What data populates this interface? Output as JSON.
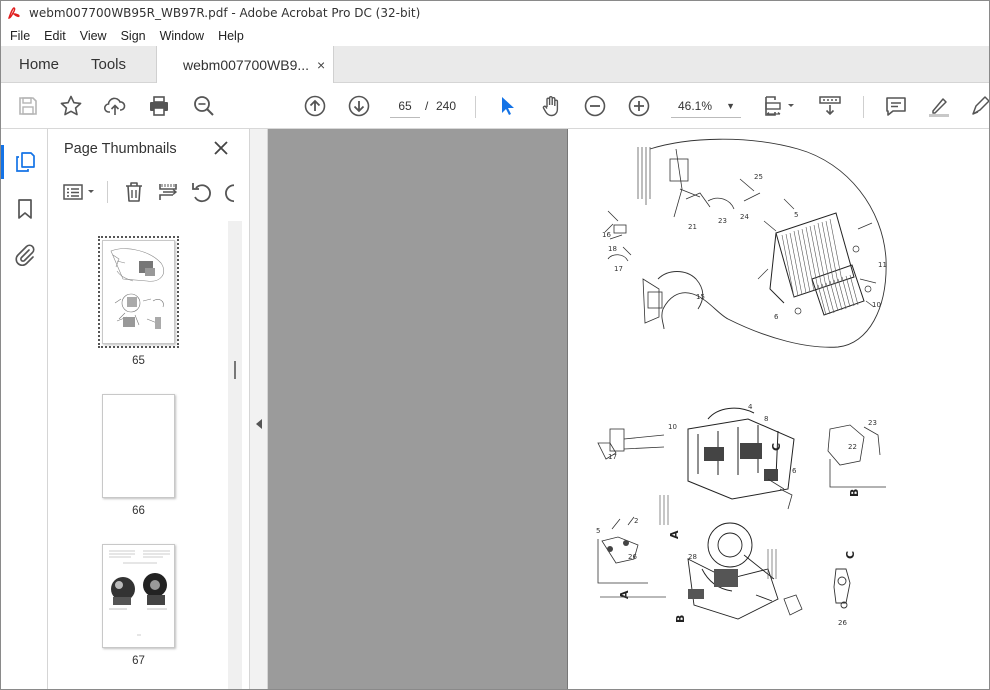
{
  "window": {
    "title": "webm007700WB95R_WB97R.pdf - Adobe Acrobat Pro DC (32-bit)"
  },
  "menu": [
    "File",
    "Edit",
    "View",
    "Sign",
    "Window",
    "Help"
  ],
  "tabs": {
    "home": "Home",
    "tools": "Tools",
    "document": "webm007700WB9...",
    "close_symbol": "×"
  },
  "toolbar": {
    "current_page": "65",
    "page_separator": "/",
    "total_pages": "240",
    "zoom": "46.1%",
    "icons": [
      "save-icon",
      "bookmark-star-icon",
      "upload-cloud-icon",
      "print-icon",
      "zoom-search-icon",
      "page-up-icon",
      "page-down-icon",
      "select-cursor-icon",
      "hand-pan-icon",
      "zoom-out-icon",
      "zoom-in-icon",
      "page-fit-icon",
      "scroll-mode-icon",
      "comment-icon",
      "highlight-pen-icon",
      "draw-pen-icon"
    ]
  },
  "left_rail": {
    "icons": [
      "page-thumbnails-icon",
      "bookmarks-icon",
      "attachments-icon"
    ],
    "active": "page-thumbnails-icon"
  },
  "thumbnails_panel": {
    "title": "Page Thumbnails",
    "close_symbol": "✕",
    "pages": [
      {
        "number": "65",
        "selected": true
      },
      {
        "number": "66",
        "selected": false
      },
      {
        "number": "67",
        "selected": false
      }
    ]
  },
  "colors": {
    "accent": "#1473e6",
    "document_background": "#9b9b9b",
    "pdf_icon_red": "#e01e1e"
  }
}
